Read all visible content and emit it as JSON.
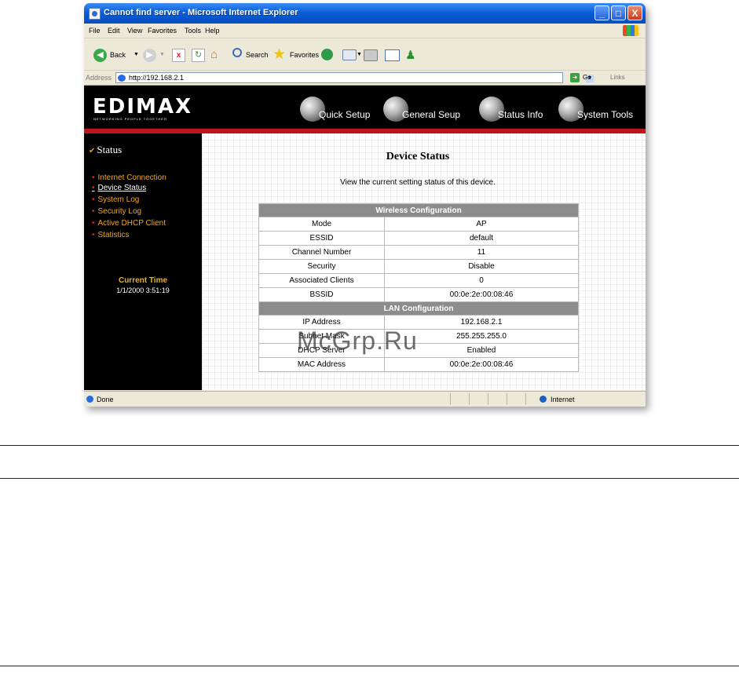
{
  "window": {
    "title": "Cannot find server - Microsoft Internet Explorer",
    "buttons": {
      "minimize": "_",
      "maximize": "□",
      "close": "X"
    }
  },
  "menu": [
    "File",
    "Edit",
    "View",
    "Favorites",
    "Tools",
    "Help"
  ],
  "toolbar": {
    "back": "Back",
    "search": "Search",
    "favorites": "Favorites"
  },
  "address": {
    "label": "Address",
    "url": "http://192.168.2.1",
    "go": "Go",
    "links": "Links"
  },
  "header": {
    "logo": "EDIMAX",
    "tagline": "NETWORKING PEOPLE TOGETHER",
    "nav": [
      {
        "label": "Quick Setup"
      },
      {
        "label": "General Seup"
      },
      {
        "label": "Status Info"
      },
      {
        "label": "System Tools"
      }
    ]
  },
  "sidebar": {
    "title": "Status",
    "items": [
      {
        "label": "Internet Connection"
      },
      {
        "label": "Device Status"
      },
      {
        "label": "System Log"
      },
      {
        "label": "Security Log"
      },
      {
        "label": "Active DHCP Client"
      },
      {
        "label": "Statistics"
      }
    ],
    "current_time_label": "Current Time",
    "current_time": "1/1/2000 3:51:19"
  },
  "main": {
    "title": "Device Status",
    "description": "View the current setting status of this device.",
    "wireless_header": "Wireless Configuration",
    "wireless_rows": [
      {
        "label": "Mode",
        "value": "AP"
      },
      {
        "label": "ESSID",
        "value": "default"
      },
      {
        "label": "Channel Number",
        "value": "11"
      },
      {
        "label": "Security",
        "value": "Disable"
      },
      {
        "label": "Associated Clients",
        "value": "0"
      },
      {
        "label": "BSSID",
        "value": "00:0e:2e:00:08:46"
      }
    ],
    "lan_header": "LAN Configuration",
    "lan_rows": [
      {
        "label": "IP Address",
        "value": "192.168.2.1"
      },
      {
        "label": "Subnet Mask",
        "value": "255.255.255.0"
      },
      {
        "label": "DHCP Server",
        "value": "Enabled"
      },
      {
        "label": "MAC Address",
        "value": "00:0e:2e:00:08:46"
      }
    ]
  },
  "statusbar": {
    "status": "Done",
    "zone": "Internet"
  },
  "watermark": "McGrp.Ru"
}
